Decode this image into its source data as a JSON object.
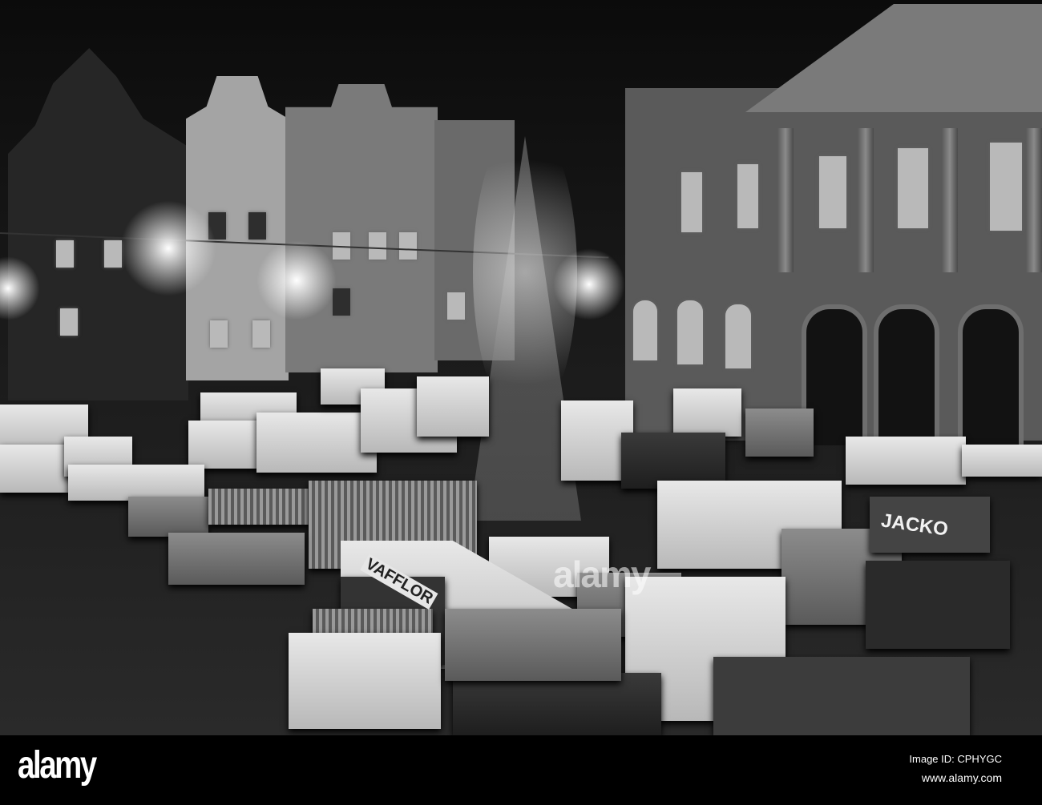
{
  "photo": {
    "subject": "Christmas market in a town square at night",
    "signs": {
      "stall_sign_1": "JACKO",
      "stall_sign_2": "VAFFLOR"
    }
  },
  "watermark": {
    "logo": "alamy",
    "center_mark": "alamy",
    "image_id": "Image ID: CPHYGC",
    "website": "www.alamy.com"
  }
}
